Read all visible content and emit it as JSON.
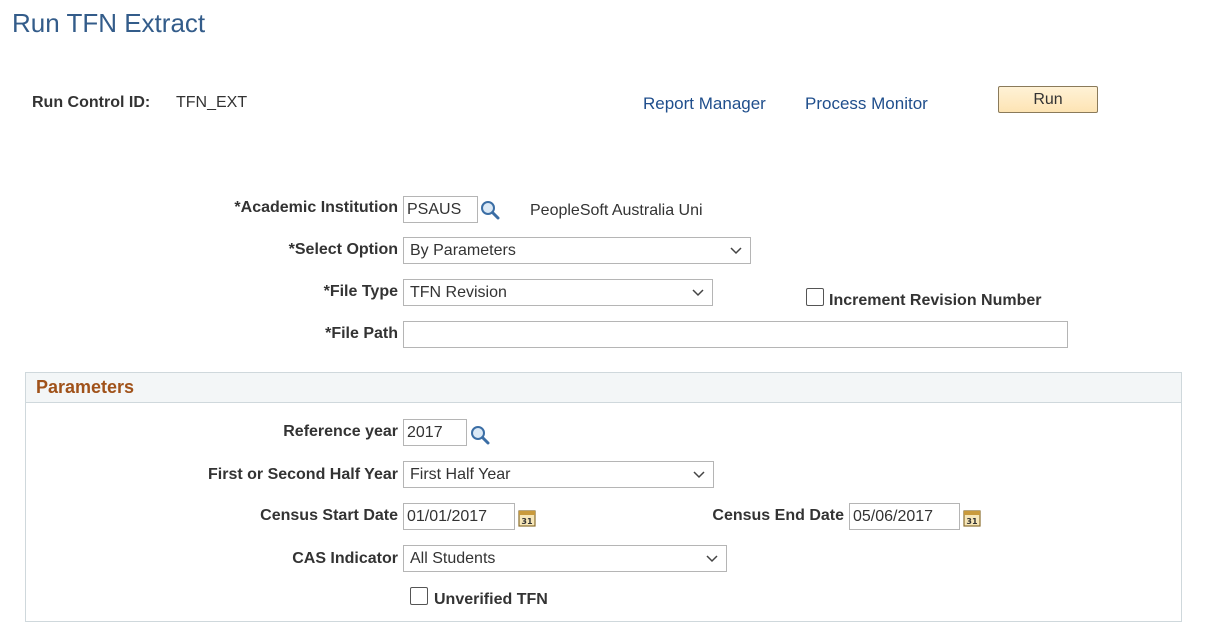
{
  "page": {
    "title": "Run TFN Extract"
  },
  "run_control": {
    "label": "Run Control ID:",
    "value": "TFN_EXT",
    "report_manager": "Report Manager",
    "process_monitor": "Process Monitor",
    "run_button": "Run"
  },
  "form": {
    "institution_label": "*Academic Institution",
    "institution_value": "PSAUS",
    "institution_desc": "PeopleSoft Australia Uni",
    "select_option_label": "*Select Option",
    "select_option_value": "By Parameters",
    "file_type_label": "*File Type",
    "file_type_value": "TFN Revision",
    "increment_label": "Increment Revision Number",
    "increment_checked": false,
    "file_path_label": "*File Path",
    "file_path_value": ""
  },
  "parameters": {
    "title": "Parameters",
    "ref_year_label": "Reference year",
    "ref_year_value": "2017",
    "half_year_label": "First or Second Half Year",
    "half_year_value": "First Half Year",
    "census_start_label": "Census Start Date",
    "census_start_value": "01/01/2017",
    "census_end_label": "Census End Date",
    "census_end_value": "05/06/2017",
    "cas_label": "CAS Indicator",
    "cas_value": "All Students",
    "unverified_label": "Unverified TFN",
    "unverified_checked": false
  },
  "icons": {
    "lookup": "magnifier-icon",
    "calendar": "calendar-icon",
    "dropdown": "chevron-down-icon"
  },
  "colors": {
    "title": "#335c8a",
    "link": "#1f4e8c",
    "group_title": "#a0521a",
    "run_button_bg": "#fde4b4"
  }
}
